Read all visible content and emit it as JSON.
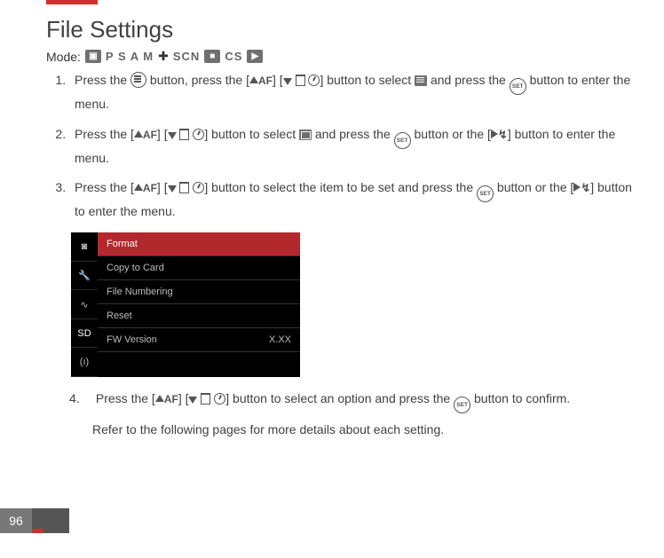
{
  "title": "File Settings",
  "mode_label": "Mode:",
  "mode_text": "P S A M",
  "mode_text2": "SCN",
  "mode_text3": "CS",
  "steps": {
    "s1a": "Press the ",
    "s1b": " button, press the ",
    "s1c": " button to select ",
    "s1d": " and press the ",
    "s1e": " button to enter the menu.",
    "s2a": "Press the ",
    "s2b": " button to select ",
    "s2c": " and press the ",
    "s2d": " button or the ",
    "s2e": "  button to enter the menu.",
    "s3a": "Press the ",
    "s3b": " button to select the item to be set and press the ",
    "s3c": " button or the ",
    "s3d": "  button to enter the menu.",
    "s4num": "4.",
    "s4a": "Press the ",
    "s4b": " button to select an option and press the ",
    "s4c": " button to confirm."
  },
  "btn_set_label": "SET",
  "af_label": "AF",
  "bracket_open": "[",
  "bracket_close": "]",
  "slash": " / ",
  "lcd": {
    "items": [
      "Format",
      "Copy to Card",
      "File Numbering",
      "Reset"
    ],
    "fw_label": "FW Version",
    "fw_value": "X.XX"
  },
  "refer": "Refer to the following pages for more details about each setting.",
  "page_number": "96"
}
